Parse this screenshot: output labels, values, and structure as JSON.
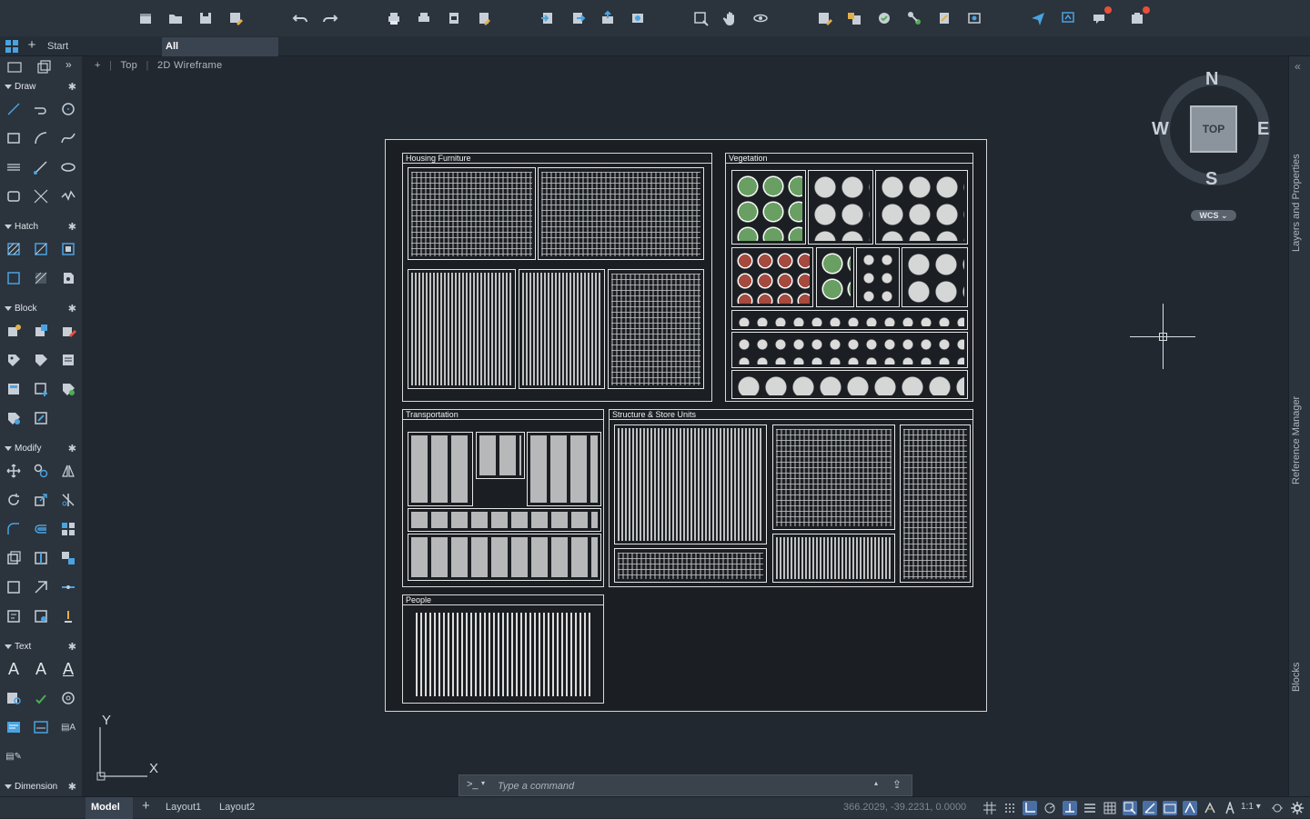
{
  "toolbar": {
    "icons": [
      "new-file-icon",
      "open-file-icon",
      "save-icon",
      "save-as-icon",
      "undo-icon",
      "redo-icon",
      "plot-icon",
      "batch-plot-icon",
      "export-pdf-icon",
      "publish-icon",
      "import-icon",
      "export-icon",
      "upload-icon",
      "share-icon",
      "select-window-icon",
      "pan-hand-icon",
      "orbit-icon",
      "layer-properties-icon",
      "attach-icon",
      "xref-icon",
      "link-icon",
      "measure-icon",
      "tool-palette-icon",
      "send-icon",
      "present-icon",
      "notifications-icon",
      "updates-icon"
    ]
  },
  "tabs": {
    "new_tab_symbol": "+",
    "start_label": "Start",
    "active_label": "All"
  },
  "viewport": {
    "control_minus": "+",
    "view_name": "Top",
    "visual_style": "2D Wireframe"
  },
  "palette": {
    "draw": "Draw",
    "hatch": "Hatch",
    "block": "Block",
    "modify": "Modify",
    "text": "Text",
    "dimension": "Dimension"
  },
  "drawing": {
    "housing_title": "Housing Furniture",
    "vegetation_title": "Vegetation",
    "transportation_title": "Transportation",
    "structure_title": "Structure & Store Units",
    "people_title": "People"
  },
  "navcube": {
    "north": "N",
    "south": "S",
    "east": "E",
    "west": "W",
    "face": "TOP",
    "wcs": "WCS"
  },
  "ucs": {
    "x_label": "X",
    "y_label": "Y"
  },
  "right_panels": {
    "layers": "Layers and Properties",
    "reference": "Reference Manager",
    "blocks": "Blocks"
  },
  "command": {
    "prompt": ">_",
    "placeholder": "Type a command"
  },
  "status": {
    "model_tab": "Model",
    "add_layout": "+",
    "layout1": "Layout1",
    "layout2": "Layout2",
    "coordinates": "366.2029, -39.2231, 0.0000",
    "annotation_scale": "1:1"
  },
  "colors": {
    "accent": "#4a6fa5",
    "background": "#212830",
    "badge": "#e8503a"
  }
}
